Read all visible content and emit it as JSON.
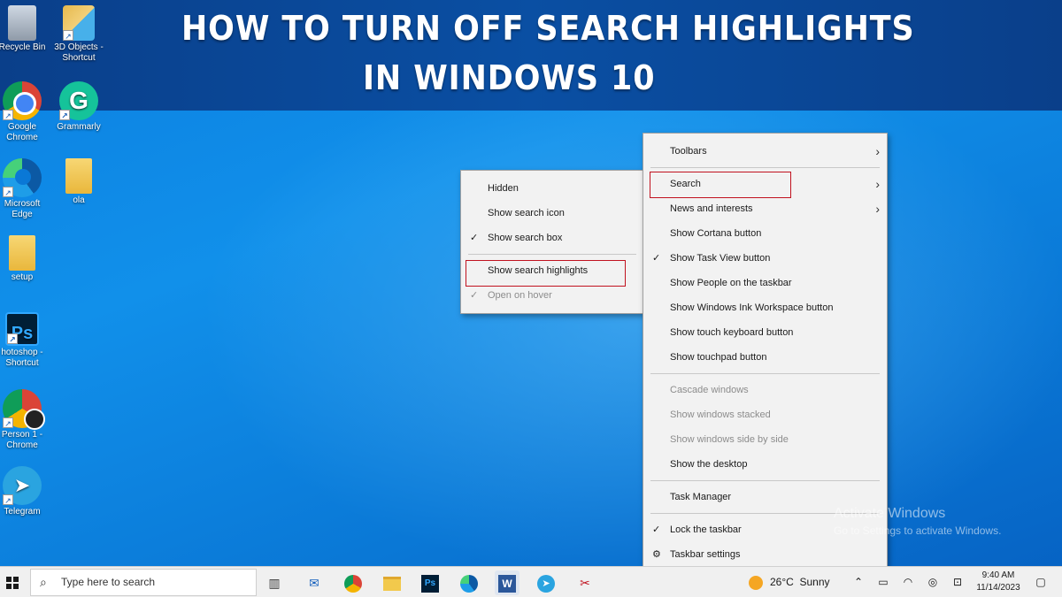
{
  "banner": {
    "line1": "HOW  TO  TURN  OFF  SEARCH HIGHLIGHTS",
    "line2": "IN  WINDOWS  10"
  },
  "desktop_icons": [
    {
      "label": "Recycle Bin",
      "icon": "recycle-bin-icon"
    },
    {
      "label": "3D Objects - Shortcut",
      "icon": "folder-3d-objects-icon"
    },
    {
      "label": "Google Chrome",
      "icon": "chrome-icon"
    },
    {
      "label": "Grammarly",
      "icon": "grammarly-icon"
    },
    {
      "label": "Microsoft Edge",
      "icon": "edge-icon"
    },
    {
      "label": "ola",
      "icon": "folder-icon"
    },
    {
      "label": "setup",
      "icon": "folder-icon"
    },
    {
      "label": "hotoshop - Shortcut",
      "icon": "photoshop-icon"
    },
    {
      "label": "Person 1 - Chrome",
      "icon": "chrome-profile-icon"
    },
    {
      "label": "Telegram",
      "icon": "telegram-icon"
    }
  ],
  "search_submenu": {
    "items": [
      {
        "label": "Hidden",
        "checked": false,
        "disabled": false
      },
      {
        "label": "Show search icon",
        "checked": false,
        "disabled": false
      },
      {
        "label": "Show search box",
        "checked": true,
        "disabled": false
      },
      {
        "label": "Show search highlights",
        "checked": false,
        "disabled": false
      },
      {
        "label": "Open on hover",
        "checked": true,
        "disabled": true
      }
    ]
  },
  "taskbar_menu": {
    "items": [
      {
        "label": "Toolbars",
        "submenu": true
      },
      {
        "label": "Search",
        "submenu": true
      },
      {
        "label": "News and interests",
        "submenu": true
      },
      {
        "label": "Show Cortana button"
      },
      {
        "label": "Show Task View button",
        "checked": true
      },
      {
        "label": "Show People on the taskbar"
      },
      {
        "label": "Show Windows Ink Workspace button"
      },
      {
        "label": "Show touch keyboard button"
      },
      {
        "label": "Show touchpad button"
      },
      {
        "label": "Cascade windows",
        "disabled": true
      },
      {
        "label": "Show windows stacked",
        "disabled": true
      },
      {
        "label": "Show windows side by side",
        "disabled": true
      },
      {
        "label": "Show the desktop"
      },
      {
        "label": "Task Manager"
      },
      {
        "label": "Lock the taskbar",
        "checked": true
      },
      {
        "label": "Taskbar settings",
        "icon": "gear-icon"
      }
    ],
    "check_glyph": "✓",
    "arrow_glyph": "›"
  },
  "watermark": {
    "title": "Activate Windows",
    "subtitle": "Go to Settings to activate Windows."
  },
  "taskbar": {
    "search_placeholder": "Type here to search",
    "pinned_apps": [
      "task-view-icon",
      "mail-icon",
      "chrome-icon",
      "file-explorer-icon",
      "photoshop-icon",
      "edge-icon",
      "word-icon",
      "telegram-icon",
      "snipping-tool-icon"
    ],
    "weather": {
      "temp": "26°C",
      "condition": "Sunny"
    },
    "clock": {
      "time": "9:40 AM",
      "date": "11/14/2023"
    }
  },
  "colors": {
    "highlight_box": "#c1121f",
    "banner": "#0a4fa3",
    "desktop": "#0a85e0"
  }
}
